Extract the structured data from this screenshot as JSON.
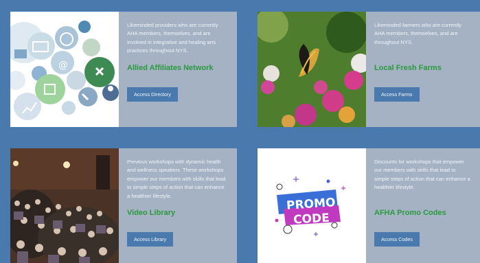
{
  "cards": [
    {
      "description": "Likeminded providers who are currently AHA members, themselves, and are involved in integrative and healing arts practices throughout NYS.",
      "title": "Allied Affiliates Network",
      "button": "Access Directory",
      "image": "network-icons-collage"
    },
    {
      "description": "Likeminded farmers who are currently AHA members, themselves, and are throughout NYS.",
      "title": "Local Fresh Farms",
      "button": "Access Farms",
      "image": "butterfly-on-flowers-photo"
    },
    {
      "description": "Previous workshops with dynamic health and wellness speakers. These workshops empower our members with skills that lead to simple steps of action that can enhance a healthier lifestyle.",
      "title": "Video Library",
      "button": "Access Library",
      "image": "auditorium-audience-photo"
    },
    {
      "description": "Discounts for workshops that empower our members with skills that lead to simple steps of action that can enhance a healthier lifestyle.",
      "title": "AFHA Promo Codes",
      "button": "Access Codes",
      "image": "promo-code-graphic",
      "promo_line1": "PROMO",
      "promo_line2": "CODE"
    }
  ],
  "colors": {
    "page_background": "#4a79ad",
    "card_background": "#a4b2c4",
    "title_green": "#2a9a3c",
    "button_blue": "#4a79ad"
  }
}
